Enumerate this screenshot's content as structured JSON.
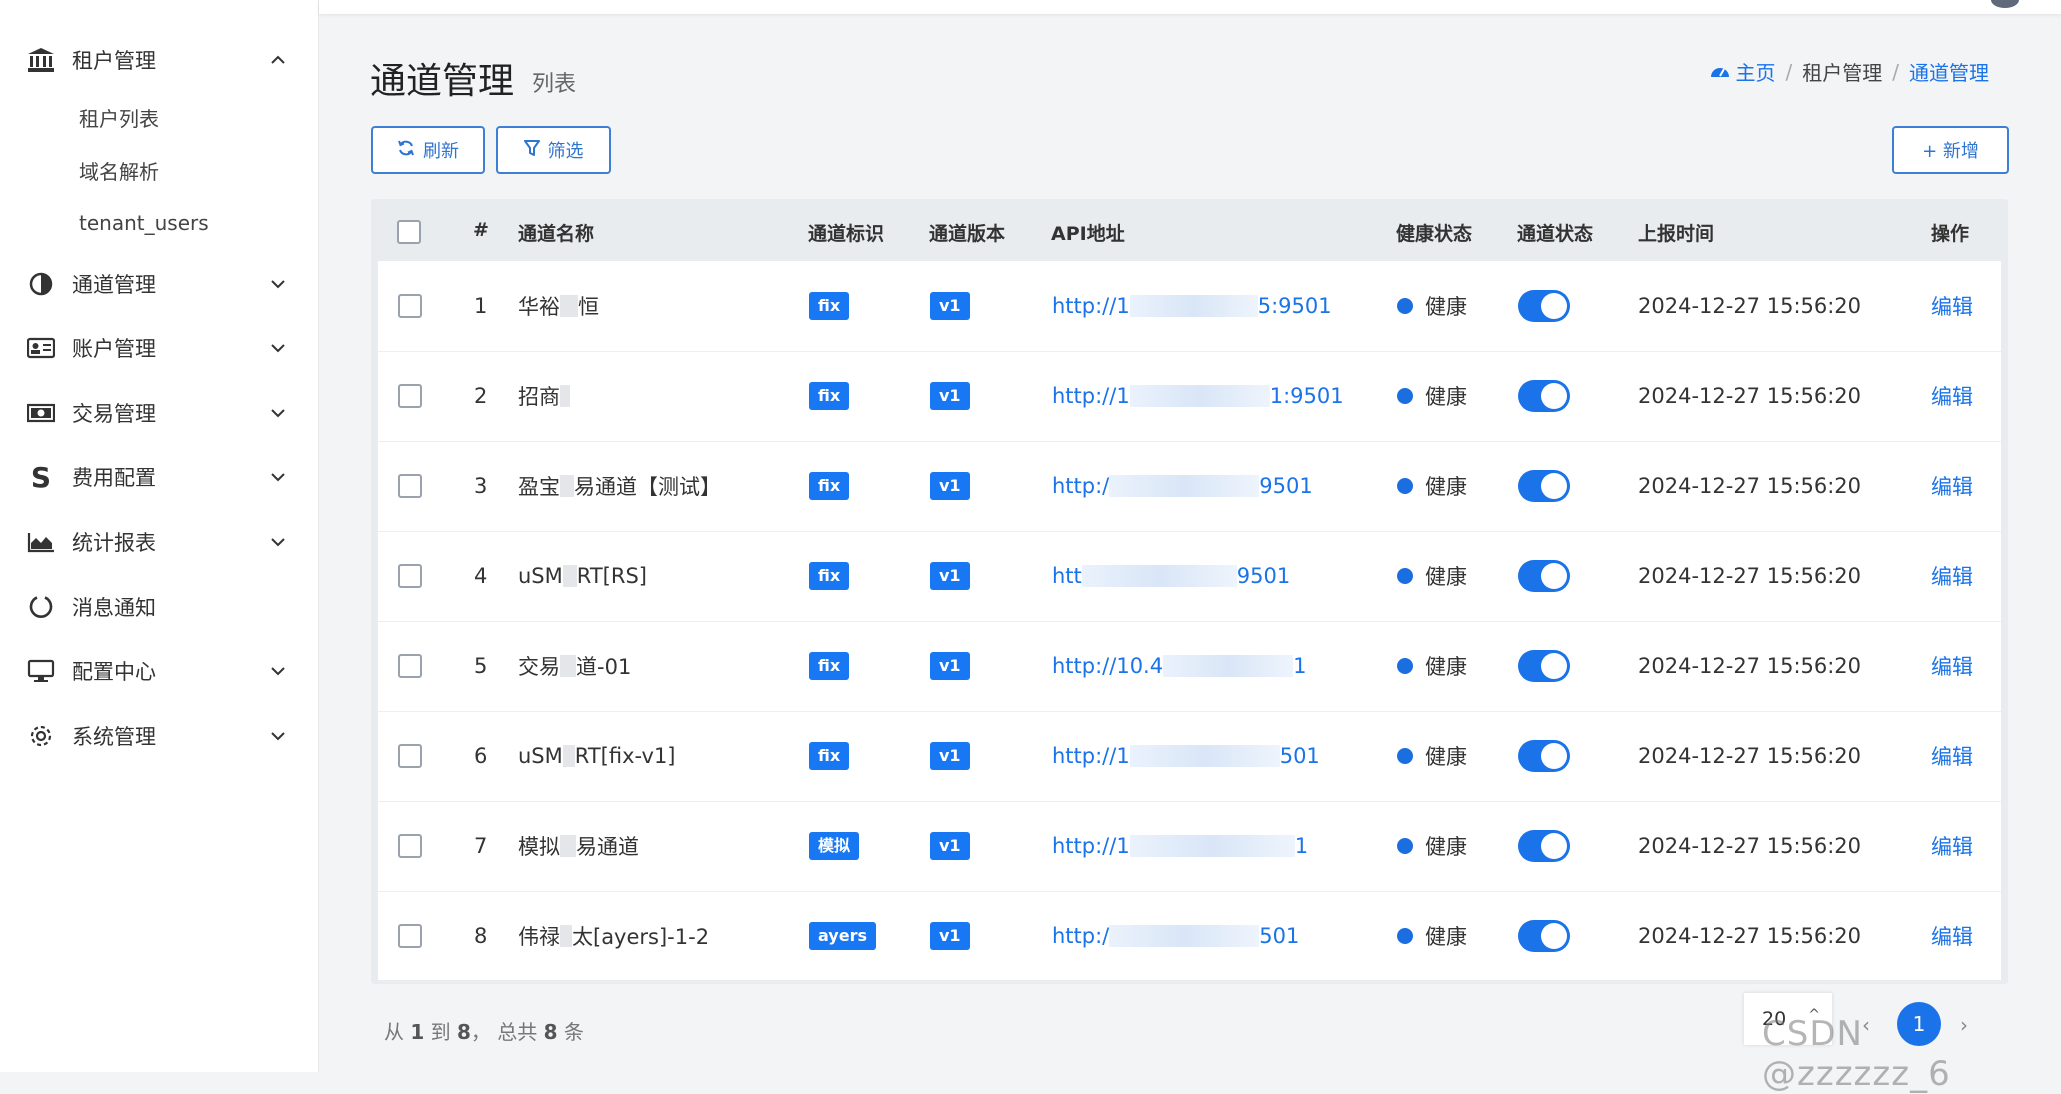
{
  "sidebar": {
    "items": [
      {
        "label": "租户管理",
        "icon": "bank-icon",
        "expanded": true,
        "children": [
          "租户列表",
          "域名解析",
          "tenant_users"
        ]
      },
      {
        "label": "通道管理",
        "icon": "half-circle-icon"
      },
      {
        "label": "账户管理",
        "icon": "id-card-icon"
      },
      {
        "label": "交易管理",
        "icon": "money-icon"
      },
      {
        "label": "费用配置",
        "icon": "dollar-icon"
      },
      {
        "label": "统计报表",
        "icon": "area-chart-icon"
      },
      {
        "label": "消息通知",
        "icon": "circle-notch-icon"
      },
      {
        "label": "配置中心",
        "icon": "monitor-icon"
      },
      {
        "label": "系统管理",
        "icon": "gear-icon"
      }
    ]
  },
  "header": {
    "title": "通道管理",
    "subtitle": "列表",
    "breadcrumb": {
      "home": "主页",
      "mid": "租户管理",
      "current": "通道管理"
    }
  },
  "toolbar": {
    "refresh": "刷新",
    "filter": "筛选",
    "add": "+ 新增"
  },
  "table": {
    "headers": {
      "num": "#",
      "name": "通道名称",
      "tag": "通道标识",
      "version": "通道版本",
      "api": "API地址",
      "health": "健康状态",
      "status": "通道状态",
      "time": "上报时间",
      "action": "操作"
    },
    "rows": [
      {
        "num": "1",
        "name_pre": "华裕",
        "name_post": "恒",
        "tag": "fix",
        "version": "v1",
        "api_pre": "http://1",
        "api_post": "5:9501",
        "health": "健康",
        "time": "2024-12-27 15:56:20",
        "action": "编辑"
      },
      {
        "num": "2",
        "name_pre": "招商",
        "name_post": "",
        "tag": "fix",
        "version": "v1",
        "api_pre": "http://1",
        "api_post": "1:9501",
        "health": "健康",
        "time": "2024-12-27 15:56:20",
        "action": "编辑"
      },
      {
        "num": "3",
        "name_pre": "盈宝",
        "name_post": "易通道【测试】",
        "tag": "fix",
        "version": "v1",
        "api_pre": "http:/",
        "api_post": "9501",
        "health": "健康",
        "time": "2024-12-27 15:56:20",
        "action": "编辑"
      },
      {
        "num": "4",
        "name_pre": "uSM",
        "name_post": "RT[RS]",
        "tag": "fix",
        "version": "v1",
        "api_pre": "htt",
        "api_post": "9501",
        "health": "健康",
        "time": "2024-12-27 15:56:20",
        "action": "编辑"
      },
      {
        "num": "5",
        "name_pre": "交易",
        "name_post": "道-01",
        "tag": "fix",
        "version": "v1",
        "api_pre": "http://10.4",
        "api_post": "1",
        "health": "健康",
        "time": "2024-12-27 15:56:20",
        "action": "编辑"
      },
      {
        "num": "6",
        "name_pre": "uSM",
        "name_post": "RT[fix-v1]",
        "tag": "fix",
        "version": "v1",
        "api_pre": "http://1",
        "api_post": "501",
        "health": "健康",
        "time": "2024-12-27 15:56:20",
        "action": "编辑"
      },
      {
        "num": "7",
        "name_pre": "模拟",
        "name_post": "易通道",
        "tag": "模拟",
        "version": "v1",
        "api_pre": "http://1",
        "api_post": "1",
        "health": "健康",
        "time": "2024-12-27 15:56:20",
        "action": "编辑"
      },
      {
        "num": "8",
        "name_pre": "伟禄",
        "name_post": "太[ayers]-1-2",
        "tag": "ayers",
        "version": "v1",
        "api_pre": "http:/",
        "api_post": "501",
        "health": "健康",
        "time": "2024-12-27 15:56:20",
        "action": "编辑"
      }
    ]
  },
  "footer": {
    "summary_a": "从 ",
    "from": "1",
    "summary_b": " 到 ",
    "to": "8",
    "summary_c": "， 总共 ",
    "total": "8",
    "summary_d": " 条",
    "page_size": "20",
    "current_page": "1",
    "prev": "‹",
    "next": "›"
  },
  "watermark": "CSDN @zzzzzz_6"
}
